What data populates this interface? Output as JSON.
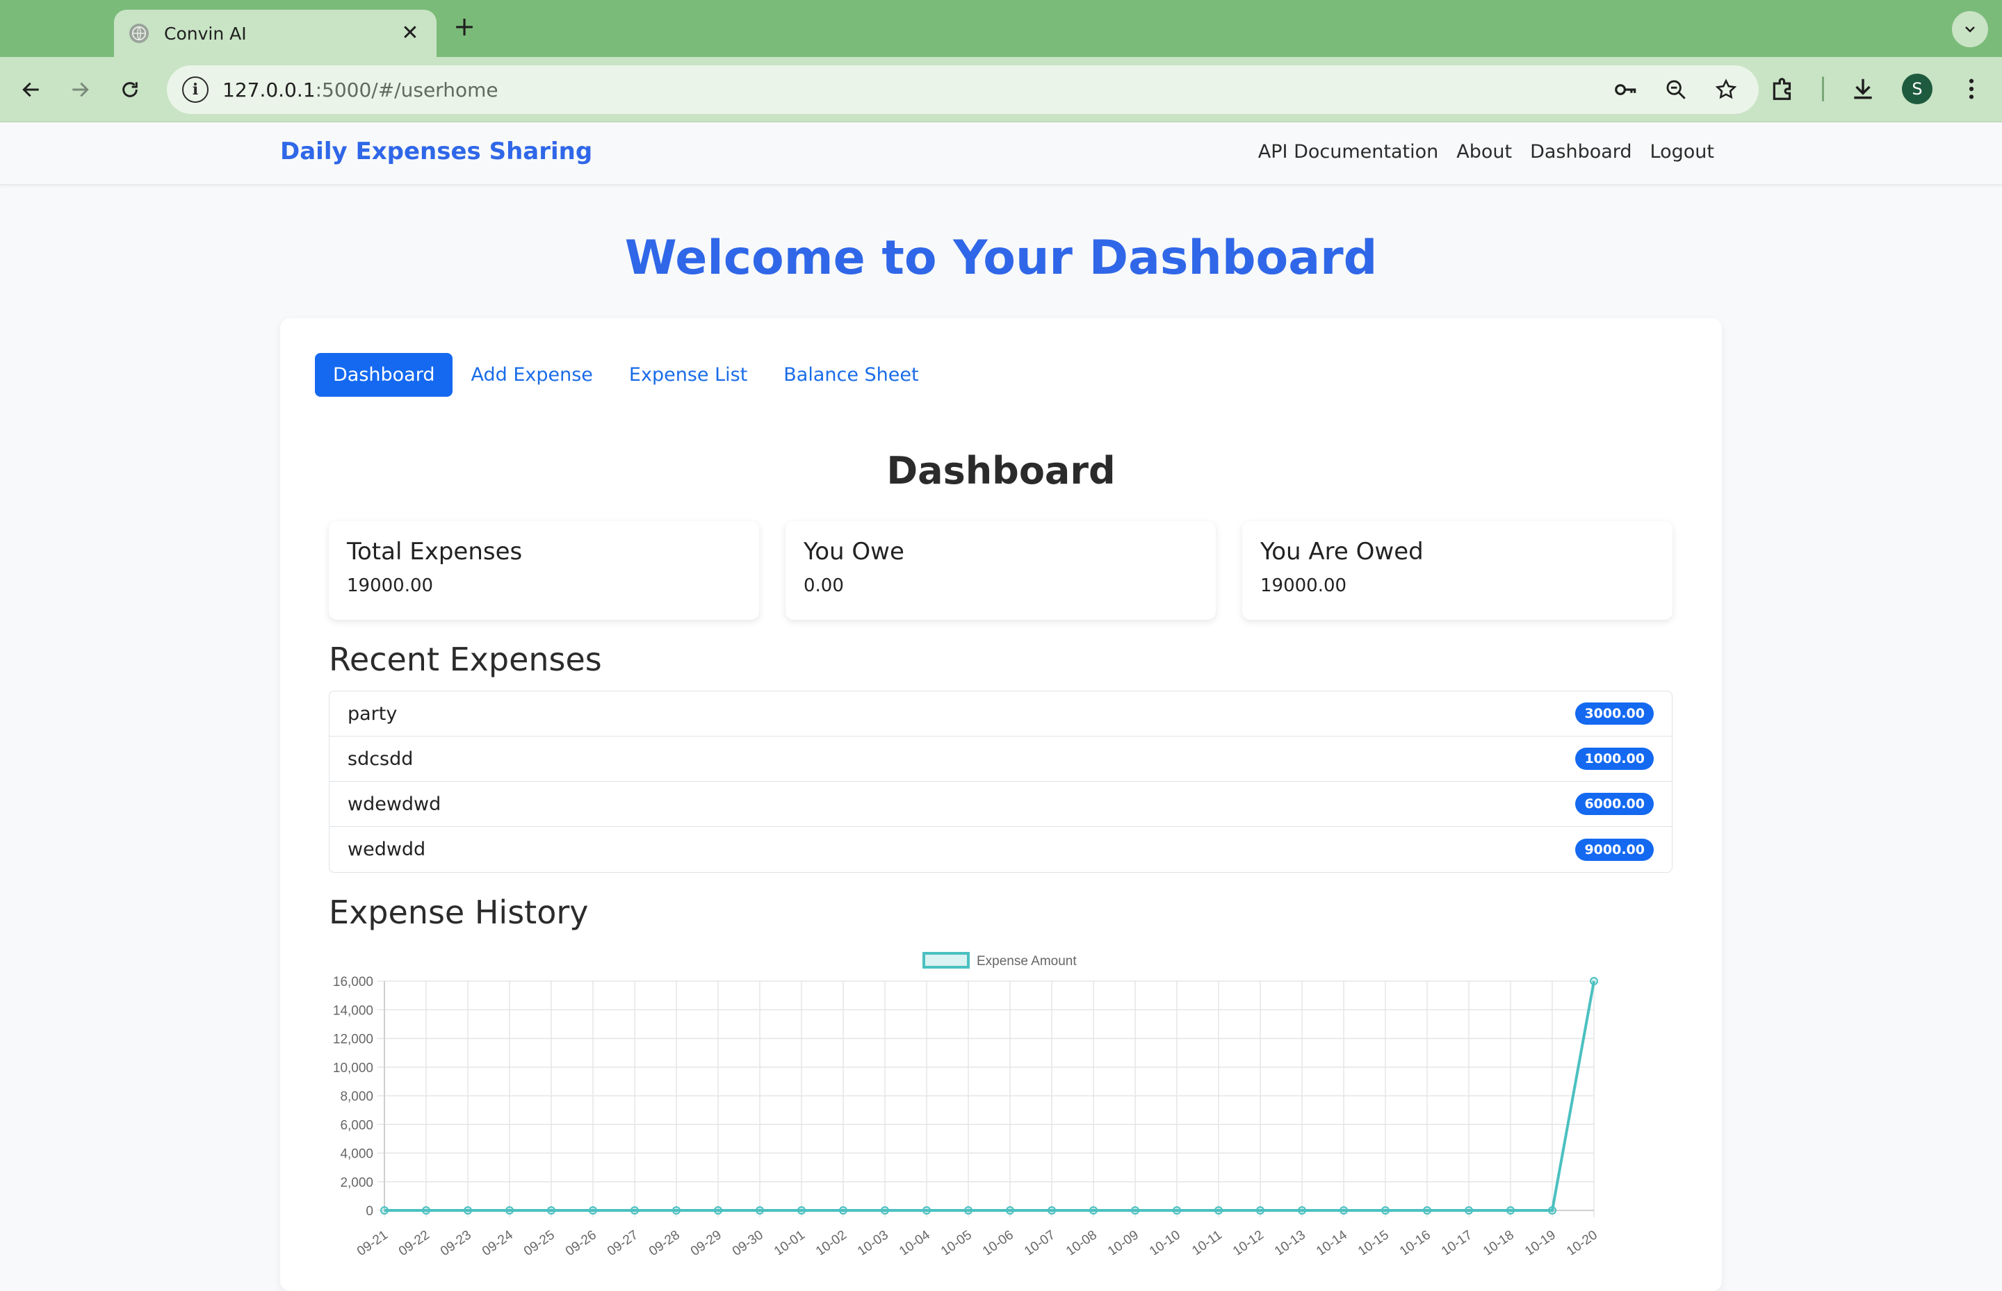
{
  "browser": {
    "tab_title": "Convin AI",
    "url_host": "127.0.0.1",
    "url_rest": ":5000/#/userhome",
    "profile_initial": "S"
  },
  "nav": {
    "brand": "Daily Expenses Sharing",
    "links": [
      "API Documentation",
      "About",
      "Dashboard",
      "Logout"
    ]
  },
  "page": {
    "welcome": "Welcome to Your Dashboard",
    "tabs": [
      "Dashboard",
      "Add Expense",
      "Expense List",
      "Balance Sheet"
    ],
    "section_title": "Dashboard",
    "stats": [
      {
        "label": "Total Expenses",
        "value": "19000.00"
      },
      {
        "label": "You Owe",
        "value": "0.00"
      },
      {
        "label": "You Are Owed",
        "value": "19000.00"
      }
    ],
    "recent_title": "Recent Expenses",
    "recent": [
      {
        "name": "party",
        "amount": "3000.00"
      },
      {
        "name": "sdcsdd",
        "amount": "1000.00"
      },
      {
        "name": "wdewdwd",
        "amount": "6000.00"
      },
      {
        "name": "wedwdd",
        "amount": "9000.00"
      }
    ],
    "history_title": "Expense History"
  },
  "colors": {
    "brand": "#2f67e8",
    "primary": "#1469f0",
    "line": "#4bc0c0"
  },
  "chart_data": {
    "type": "line",
    "legend": "Expense Amount",
    "legend_position": "top",
    "grid": true,
    "ylim": [
      0,
      16000
    ],
    "yticks": [
      0,
      2000,
      4000,
      6000,
      8000,
      10000,
      12000,
      14000,
      16000
    ],
    "ytick_labels": [
      "0",
      "2,000",
      "4,000",
      "6,000",
      "8,000",
      "10,000",
      "12,000",
      "14,000",
      "16,000"
    ],
    "categories": [
      "09-21",
      "09-22",
      "09-23",
      "09-24",
      "09-25",
      "09-26",
      "09-27",
      "09-28",
      "09-29",
      "09-30",
      "10-01",
      "10-02",
      "10-03",
      "10-04",
      "10-05",
      "10-06",
      "10-07",
      "10-08",
      "10-09",
      "10-10",
      "10-11",
      "10-12",
      "10-13",
      "10-14",
      "10-15",
      "10-16",
      "10-17",
      "10-18",
      "10-19",
      "10-20"
    ],
    "series": [
      {
        "name": "Expense Amount",
        "values": [
          0,
          0,
          0,
          0,
          0,
          0,
          0,
          0,
          0,
          0,
          0,
          0,
          0,
          0,
          0,
          0,
          0,
          0,
          0,
          0,
          0,
          0,
          0,
          0,
          0,
          0,
          0,
          0,
          0,
          16000
        ]
      }
    ]
  }
}
